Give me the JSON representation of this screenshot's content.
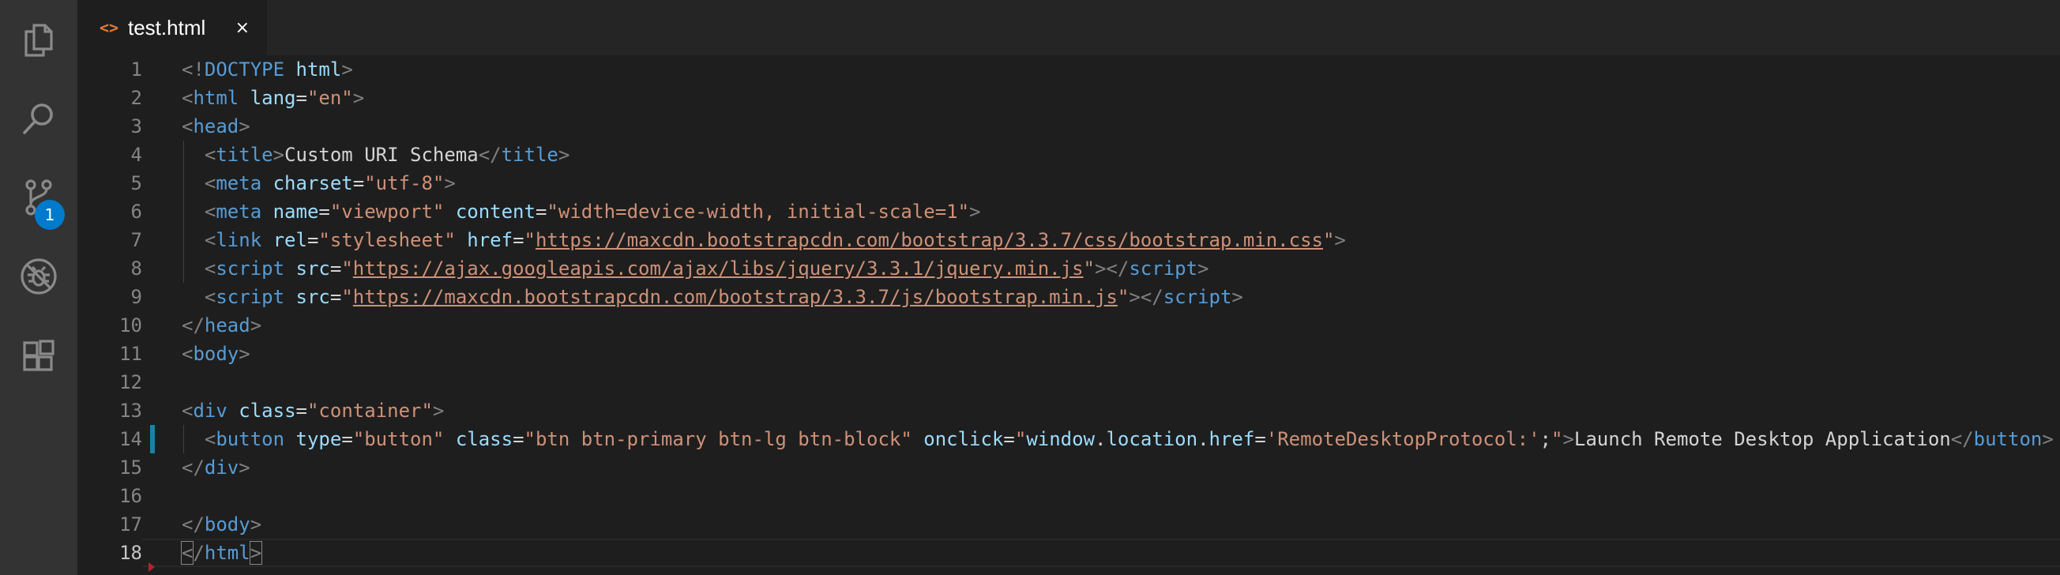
{
  "activity_bar": {
    "items": [
      {
        "name": "explorer-icon"
      },
      {
        "name": "search-icon"
      },
      {
        "name": "source-control-icon",
        "badge": "1"
      },
      {
        "name": "debug-icon"
      },
      {
        "name": "extensions-icon"
      }
    ],
    "badge_color": "#007acc"
  },
  "tab": {
    "icon": "<>",
    "label": "test.html",
    "close": "×"
  },
  "editor": {
    "line_numbers": [
      "1",
      "2",
      "3",
      "4",
      "5",
      "6",
      "7",
      "8",
      "9",
      "10",
      "11",
      "12",
      "13",
      "14",
      "15",
      "16",
      "17",
      "18"
    ],
    "active_line": "18",
    "lines": [
      [
        [
          "p",
          "<!"
        ],
        [
          "tag",
          "DOCTYPE"
        ],
        [
          "txt",
          " "
        ],
        [
          "attr",
          "html"
        ],
        [
          "p",
          ">"
        ]
      ],
      [
        [
          "p",
          "<"
        ],
        [
          "tag",
          "html"
        ],
        [
          "txt",
          " "
        ],
        [
          "attr",
          "lang"
        ],
        [
          "txt",
          "="
        ],
        [
          "str",
          "\"en\""
        ],
        [
          "p",
          ">"
        ]
      ],
      [
        [
          "p",
          "<"
        ],
        [
          "tag",
          "head"
        ],
        [
          "p",
          ">"
        ]
      ],
      [
        [
          "txt",
          "  "
        ],
        [
          "p",
          "<"
        ],
        [
          "tag",
          "title"
        ],
        [
          "p",
          ">"
        ],
        [
          "txt",
          "Custom URI Schema"
        ],
        [
          "p",
          "</"
        ],
        [
          "tag",
          "title"
        ],
        [
          "p",
          ">"
        ]
      ],
      [
        [
          "txt",
          "  "
        ],
        [
          "p",
          "<"
        ],
        [
          "tag",
          "meta"
        ],
        [
          "txt",
          " "
        ],
        [
          "attr",
          "charset"
        ],
        [
          "txt",
          "="
        ],
        [
          "str",
          "\"utf-8\""
        ],
        [
          "p",
          ">"
        ]
      ],
      [
        [
          "txt",
          "  "
        ],
        [
          "p",
          "<"
        ],
        [
          "tag",
          "meta"
        ],
        [
          "txt",
          " "
        ],
        [
          "attr",
          "name"
        ],
        [
          "txt",
          "="
        ],
        [
          "str",
          "\"viewport\""
        ],
        [
          "txt",
          " "
        ],
        [
          "attr",
          "content"
        ],
        [
          "txt",
          "="
        ],
        [
          "str",
          "\"width=device-width, initial-scale=1\""
        ],
        [
          "p",
          ">"
        ]
      ],
      [
        [
          "txt",
          "  "
        ],
        [
          "p",
          "<"
        ],
        [
          "tag",
          "link"
        ],
        [
          "txt",
          " "
        ],
        [
          "attr",
          "rel"
        ],
        [
          "txt",
          "="
        ],
        [
          "str",
          "\"stylesheet\""
        ],
        [
          "txt",
          " "
        ],
        [
          "attr",
          "href"
        ],
        [
          "txt",
          "="
        ],
        [
          "str",
          "\""
        ],
        [
          "url",
          "https://maxcdn.bootstrapcdn.com/bootstrap/3.3.7/css/bootstrap.min.css"
        ],
        [
          "str",
          "\""
        ],
        [
          "p",
          ">"
        ]
      ],
      [
        [
          "txt",
          "  "
        ],
        [
          "p",
          "<"
        ],
        [
          "tag",
          "script"
        ],
        [
          "txt",
          " "
        ],
        [
          "attr",
          "src"
        ],
        [
          "txt",
          "="
        ],
        [
          "str",
          "\""
        ],
        [
          "url",
          "https://ajax.googleapis.com/ajax/libs/jquery/3.3.1/jquery.min.js"
        ],
        [
          "str",
          "\""
        ],
        [
          "p",
          "></"
        ],
        [
          "tag",
          "script"
        ],
        [
          "p",
          ">"
        ]
      ],
      [
        [
          "txt",
          "  "
        ],
        [
          "p",
          "<"
        ],
        [
          "tag",
          "script"
        ],
        [
          "txt",
          " "
        ],
        [
          "attr",
          "src"
        ],
        [
          "txt",
          "="
        ],
        [
          "str",
          "\""
        ],
        [
          "url",
          "https://maxcdn.bootstrapcdn.com/bootstrap/3.3.7/js/bootstrap.min.js"
        ],
        [
          "str",
          "\""
        ],
        [
          "p",
          "></"
        ],
        [
          "tag",
          "script"
        ],
        [
          "p",
          ">"
        ]
      ],
      [
        [
          "p",
          "</"
        ],
        [
          "tag",
          "head"
        ],
        [
          "p",
          ">"
        ]
      ],
      [
        [
          "p",
          "<"
        ],
        [
          "tag",
          "body"
        ],
        [
          "p",
          ">"
        ]
      ],
      [],
      [
        [
          "p",
          "<"
        ],
        [
          "tag",
          "div"
        ],
        [
          "txt",
          " "
        ],
        [
          "attr",
          "class"
        ],
        [
          "txt",
          "="
        ],
        [
          "str",
          "\"container\""
        ],
        [
          "p",
          ">"
        ]
      ],
      [
        [
          "txt",
          "  "
        ],
        [
          "p",
          "<"
        ],
        [
          "tag",
          "button"
        ],
        [
          "txt",
          " "
        ],
        [
          "attr",
          "type"
        ],
        [
          "txt",
          "="
        ],
        [
          "str",
          "\"button\""
        ],
        [
          "txt",
          " "
        ],
        [
          "attr",
          "class"
        ],
        [
          "txt",
          "="
        ],
        [
          "str",
          "\"btn btn-primary btn-lg btn-block\""
        ],
        [
          "txt",
          " "
        ],
        [
          "attr",
          "onclick"
        ],
        [
          "txt",
          "="
        ],
        [
          "str",
          "\""
        ],
        [
          "attr",
          "window"
        ],
        [
          "txt",
          "."
        ],
        [
          "attr",
          "location"
        ],
        [
          "txt",
          "."
        ],
        [
          "attr",
          "href"
        ],
        [
          "txt",
          "="
        ],
        [
          "str",
          "'RemoteDesktopProtocol:'"
        ],
        [
          "txt",
          ";"
        ],
        [
          "str",
          "\""
        ],
        [
          "p",
          ">"
        ],
        [
          "txt",
          "Launch Remote Desktop Application"
        ],
        [
          "p",
          "</"
        ],
        [
          "tag",
          "button"
        ],
        [
          "p",
          ">"
        ]
      ],
      [
        [
          "p",
          "</"
        ],
        [
          "tag",
          "div"
        ],
        [
          "p",
          ">"
        ]
      ],
      [],
      [
        [
          "p",
          "</"
        ],
        [
          "tag",
          "body"
        ],
        [
          "p",
          ">"
        ]
      ],
      [
        [
          "bm",
          "<"
        ],
        [
          "p",
          "/"
        ],
        [
          "tag",
          "html"
        ],
        [
          "bm",
          ">"
        ]
      ]
    ]
  },
  "colors": {
    "background": "#1e1e1e",
    "activity_bar": "#333333",
    "tag": "#569cd6",
    "attribute": "#9cdcfe",
    "string": "#ce9178",
    "punctuation": "#808080",
    "modified_marker": "#1b81a8",
    "deleted_marker": "#b4232a"
  }
}
